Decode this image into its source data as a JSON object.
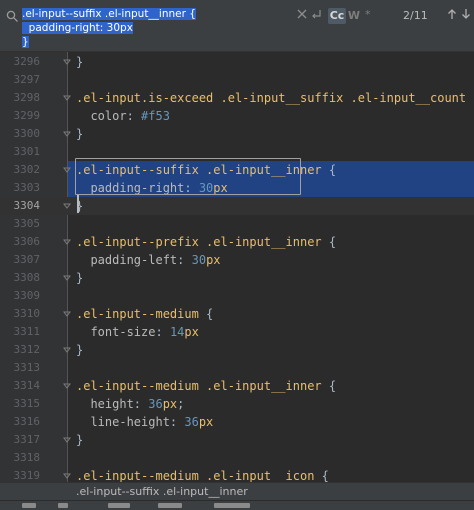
{
  "find": {
    "query_line1": ".el-input--suffix .el-input__inner {",
    "query_line2": "  padding-right: 30px",
    "query_line3": "}",
    "match_case_label": "Cc",
    "words_label": "W",
    "match_count": "2/11",
    "prev_icon": "arrow-up",
    "next_icon": "arrow-down"
  },
  "editor": {
    "current_line": 3304,
    "lines": [
      {
        "num": "3296",
        "fold": true,
        "tokens": [
          {
            "c": "t-punc",
            "t": "}"
          }
        ]
      },
      {
        "num": "3297",
        "fold": false,
        "tokens": []
      },
      {
        "num": "3298",
        "fold": true,
        "tokens": [
          {
            "c": "t-sel",
            "t": ".el-input.is-exceed .el-input__suffix .el-input__count"
          },
          {
            "c": "t-punc",
            "t": " {"
          }
        ]
      },
      {
        "num": "3299",
        "fold": false,
        "tokens": [
          {
            "c": "t-prop",
            "t": "  color"
          },
          {
            "c": "t-punc",
            "t": ": "
          },
          {
            "c": "t-hex",
            "t": "#f53"
          }
        ]
      },
      {
        "num": "3300",
        "fold": true,
        "tokens": [
          {
            "c": "t-punc",
            "t": "}"
          }
        ]
      },
      {
        "num": "3301",
        "fold": false,
        "tokens": []
      },
      {
        "num": "3302",
        "fold": true,
        "tokens": [
          {
            "c": "t-sel",
            "t": ".el-input--suffix .el-input__inner"
          },
          {
            "c": "t-punc",
            "t": " {"
          }
        ],
        "selected": true
      },
      {
        "num": "3303",
        "fold": false,
        "tokens": [
          {
            "c": "t-prop",
            "t": "  padding-right"
          },
          {
            "c": "t-punc",
            "t": ": "
          },
          {
            "c": "t-num",
            "t": "30"
          },
          {
            "c": "t-sel",
            "t": "px"
          }
        ],
        "selected": true
      },
      {
        "num": "3304",
        "fold": true,
        "tokens": [
          {
            "c": "t-punc",
            "t": "}"
          }
        ],
        "caret": true
      },
      {
        "num": "3305",
        "fold": false,
        "tokens": []
      },
      {
        "num": "3306",
        "fold": true,
        "tokens": [
          {
            "c": "t-sel",
            "t": ".el-input--prefix .el-input__inner"
          },
          {
            "c": "t-punc",
            "t": " {"
          }
        ]
      },
      {
        "num": "3307",
        "fold": false,
        "tokens": [
          {
            "c": "t-prop",
            "t": "  padding-left"
          },
          {
            "c": "t-punc",
            "t": ": "
          },
          {
            "c": "t-num",
            "t": "30"
          },
          {
            "c": "t-sel",
            "t": "px"
          }
        ]
      },
      {
        "num": "3308",
        "fold": true,
        "tokens": [
          {
            "c": "t-punc",
            "t": "}"
          }
        ]
      },
      {
        "num": "3309",
        "fold": false,
        "tokens": []
      },
      {
        "num": "3310",
        "fold": true,
        "tokens": [
          {
            "c": "t-sel",
            "t": ".el-input--medium"
          },
          {
            "c": "t-punc",
            "t": " {"
          }
        ]
      },
      {
        "num": "3311",
        "fold": false,
        "tokens": [
          {
            "c": "t-prop",
            "t": "  font-size"
          },
          {
            "c": "t-punc",
            "t": ": "
          },
          {
            "c": "t-num",
            "t": "14"
          },
          {
            "c": "t-sel",
            "t": "px"
          }
        ]
      },
      {
        "num": "3312",
        "fold": true,
        "tokens": [
          {
            "c": "t-punc",
            "t": "}"
          }
        ]
      },
      {
        "num": "3313",
        "fold": false,
        "tokens": []
      },
      {
        "num": "3314",
        "fold": true,
        "tokens": [
          {
            "c": "t-sel",
            "t": ".el-input--medium .el-input__inner"
          },
          {
            "c": "t-punc",
            "t": " {"
          }
        ]
      },
      {
        "num": "3315",
        "fold": false,
        "tokens": [
          {
            "c": "t-prop",
            "t": "  height"
          },
          {
            "c": "t-punc",
            "t": ": "
          },
          {
            "c": "t-num",
            "t": "36"
          },
          {
            "c": "t-sel",
            "t": "px"
          },
          {
            "c": "t-punc",
            "t": ";"
          }
        ]
      },
      {
        "num": "3316",
        "fold": false,
        "tokens": [
          {
            "c": "t-prop",
            "t": "  line-height"
          },
          {
            "c": "t-punc",
            "t": ": "
          },
          {
            "c": "t-num",
            "t": "36"
          },
          {
            "c": "t-sel",
            "t": "px"
          }
        ]
      },
      {
        "num": "3317",
        "fold": true,
        "tokens": [
          {
            "c": "t-punc",
            "t": "}"
          }
        ]
      },
      {
        "num": "3318",
        "fold": false,
        "tokens": []
      },
      {
        "num": "3319",
        "fold": true,
        "tokens": [
          {
            "c": "t-sel",
            "t": ".el-input--medium .el-input__icon"
          },
          {
            "c": "t-punc",
            "t": " {"
          }
        ]
      }
    ]
  },
  "breadcrumb": ".el-input--suffix .el-input__inner",
  "colors": {
    "background": "#2b2b2b",
    "selection": "#214283",
    "selector": "#e8bf6a",
    "number": "#6897bb"
  }
}
